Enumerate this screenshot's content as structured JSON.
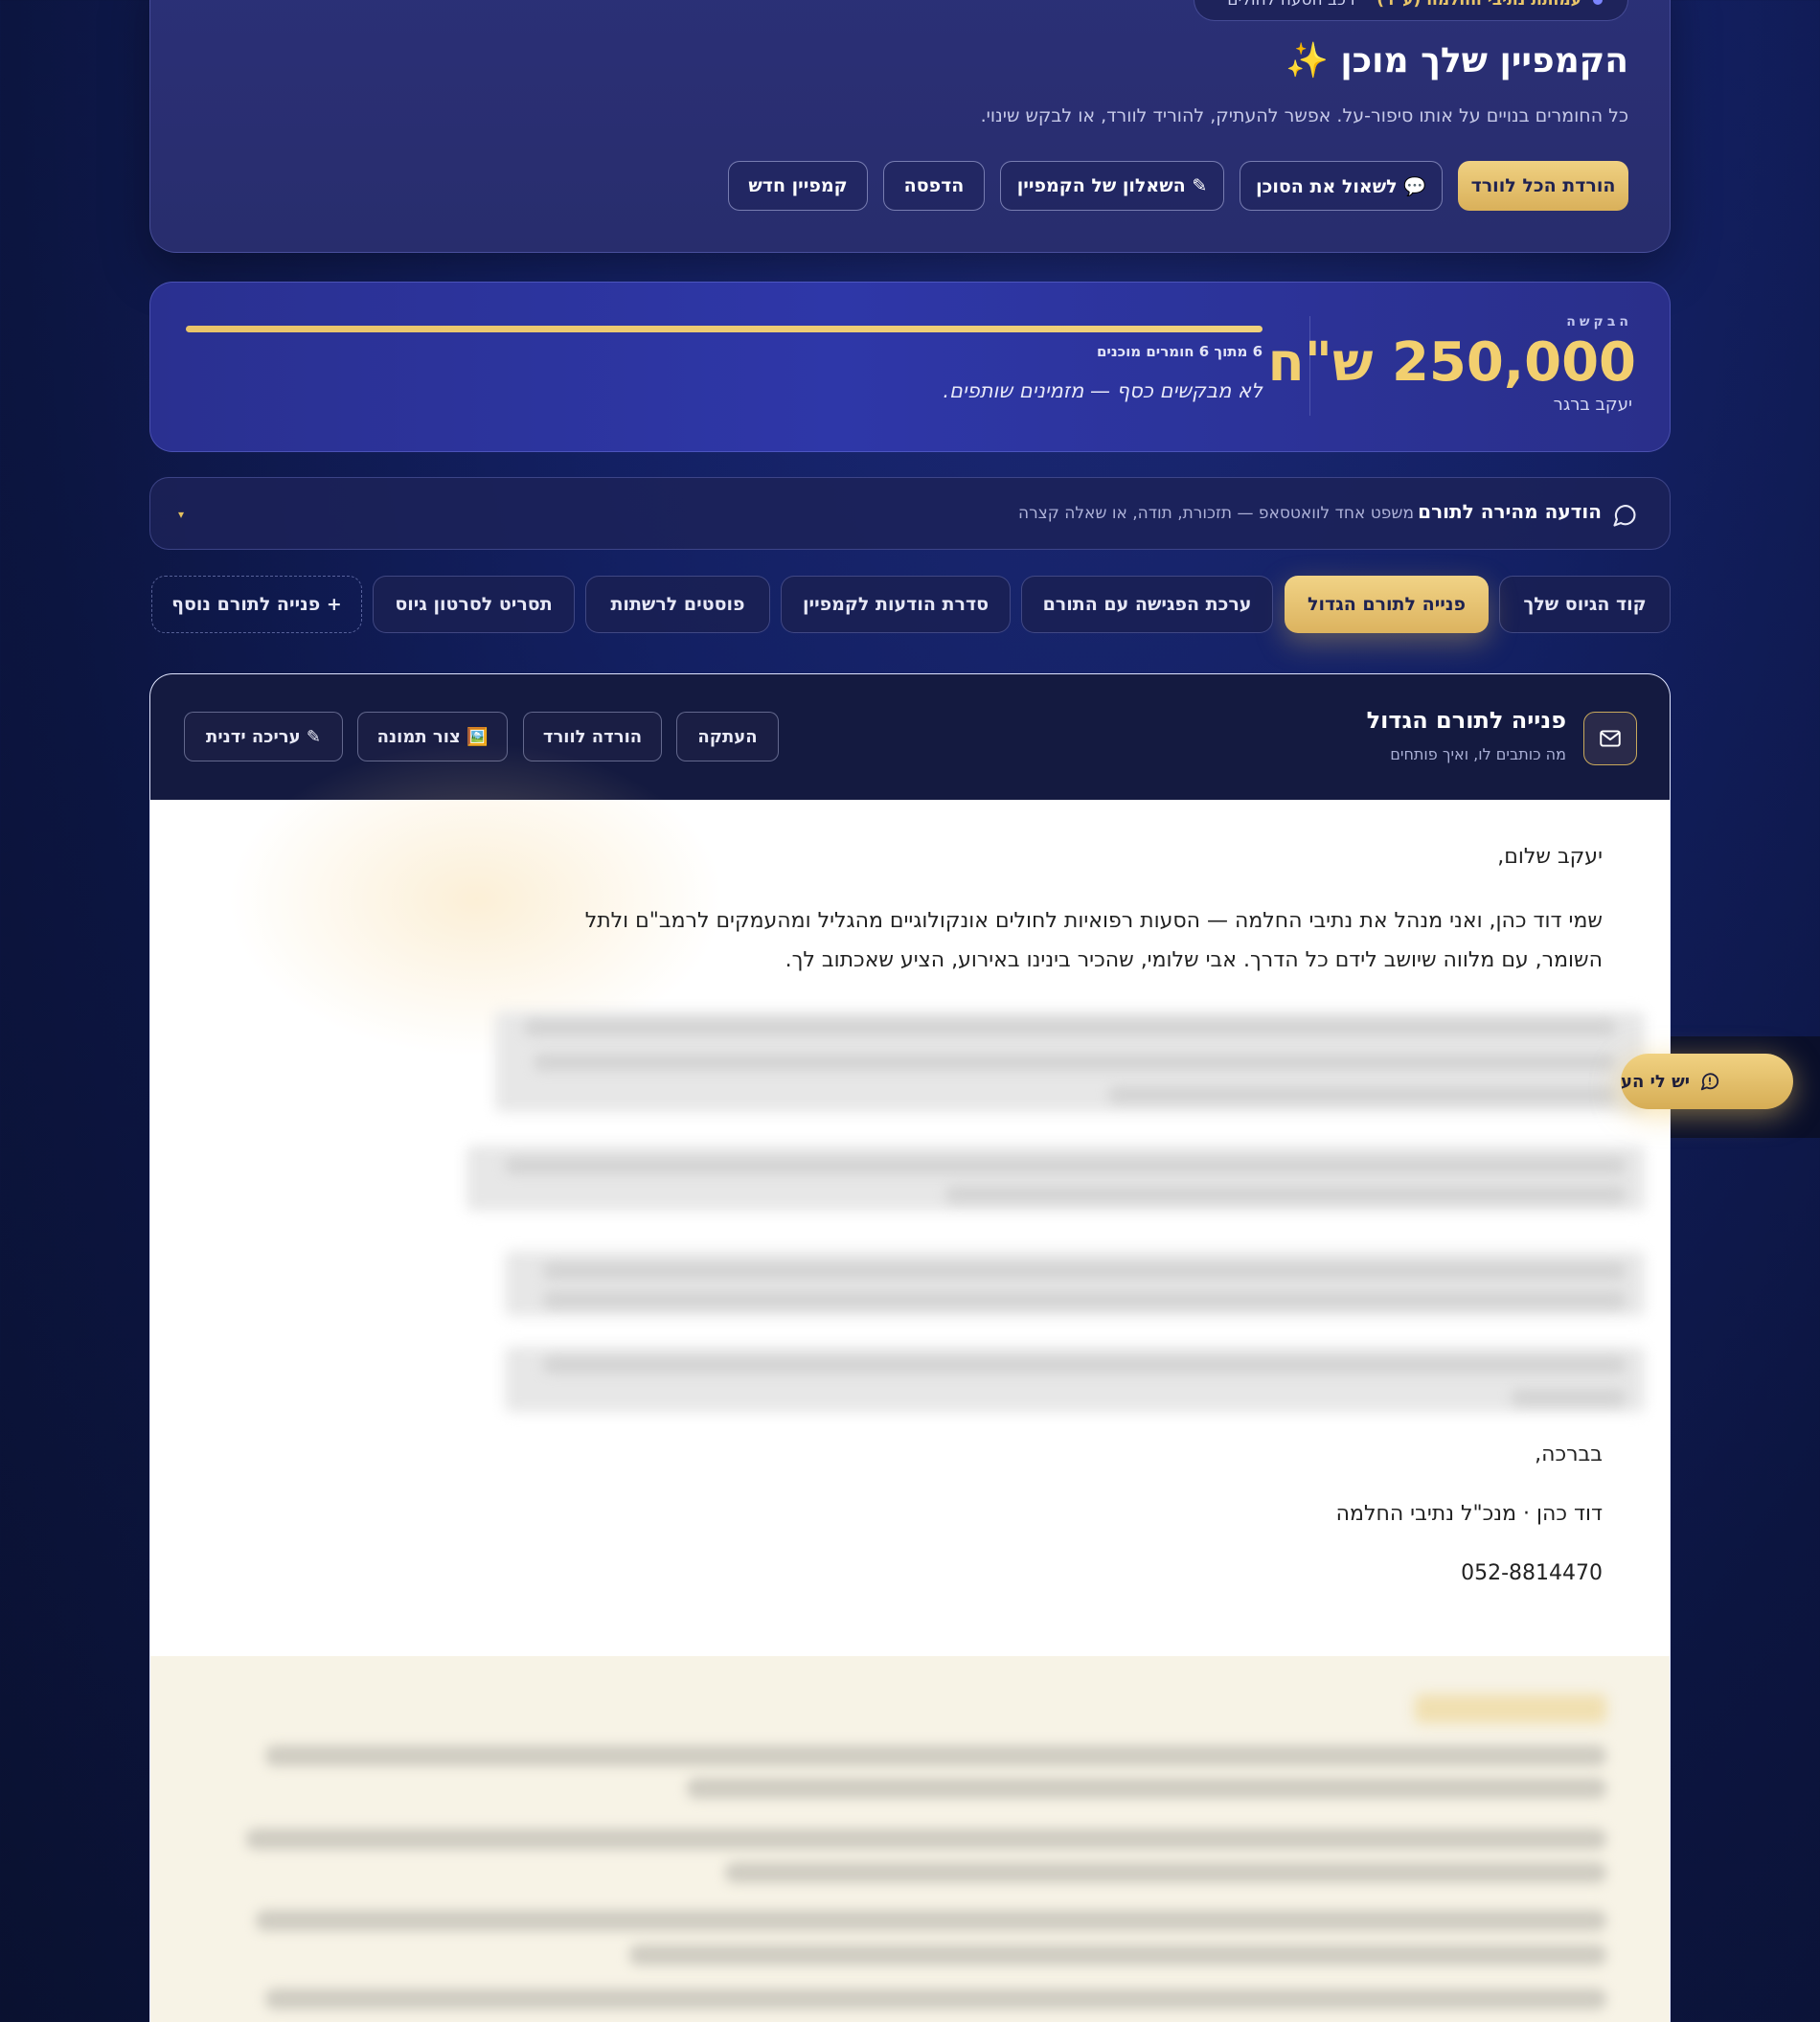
{
  "top_badge": {
    "text_bold": "עמותת נתיבי החלמה (ע\"ר)",
    "text_rest": "· רכב הסעה לחולים"
  },
  "hero": {
    "title": "הקמפיין שלך מוכן ✨",
    "subtitle": "כל החומרים בנויים על אותו סיפור-על. אפשר להעתיק, להוריד לוורד, או לבקש שינוי.",
    "buttons": {
      "download_all": "הורדת הכל לוורד",
      "ask_agent": "💬 לשאול את הסוכן",
      "questionnaire": "✎ השאלון של הקמפיין",
      "print": "הדפסה",
      "new_campaign": "קמפיין חדש"
    }
  },
  "goal": {
    "label": "הבקשה",
    "amount": "250,000 ש\"ח",
    "donor_name": "יעקב ברגר",
    "progress_text": "6 מתוך 6 חומרים מוכנים",
    "progress_fraction": 1.0,
    "quote": "לא מבקשים כסף — מזמינים שותפים."
  },
  "quick_message": {
    "title": "הודעה מהירה לתורם",
    "hint": "משפט אחד לוואטסאפ — תזכורת, תודה, או שאלה קצרה",
    "caret": "▾"
  },
  "tabs": [
    {
      "label": "קוד הגיוס שלך"
    },
    {
      "label": "פנייה לתורם הגדול"
    },
    {
      "label": "ערכת הפגישה עם התורם"
    },
    {
      "label": "סדרת הודעות לקמפיין"
    },
    {
      "label": "פוסטים לרשתות"
    },
    {
      "label": "תסריט לסרטון גיוס"
    },
    {
      "label": "+ פנייה לתורם נוסף"
    }
  ],
  "document": {
    "title": "פנייה לתורם הגדול",
    "subtitle": "מה כותבים לו, ואיך פותחים",
    "buttons": {
      "copy": "העתקה",
      "download_word": "הורדה לוורד",
      "create_image": "🖼️ צור תמונה",
      "manual_edit": "✎ עריכה ידנית"
    },
    "greeting": "יעקב שלום,",
    "paragraph": "שמי דוד כהן, ואני מנהל את נתיבי החלמה — הסעות רפואיות לחולים אונקולוגיים מהגליל ומהעמקים לרמב\"ם ולתל השומר, עם מלווה שיושב לידם כל הדרך. אבי שלומי, שהכיר בינינו באירוע, הציע שאכתוב לך.",
    "closing": "בברכה,",
    "signature": "דוד כהן · מנכ\"ל נתיבי החלמה",
    "phone": "052-8814470"
  },
  "floating_button": {
    "label": "יש לי הע"
  },
  "colors": {
    "accent_gold": "#e9c46a",
    "bg_navy": "#0c1540",
    "card_indigo": "#2b3077"
  }
}
